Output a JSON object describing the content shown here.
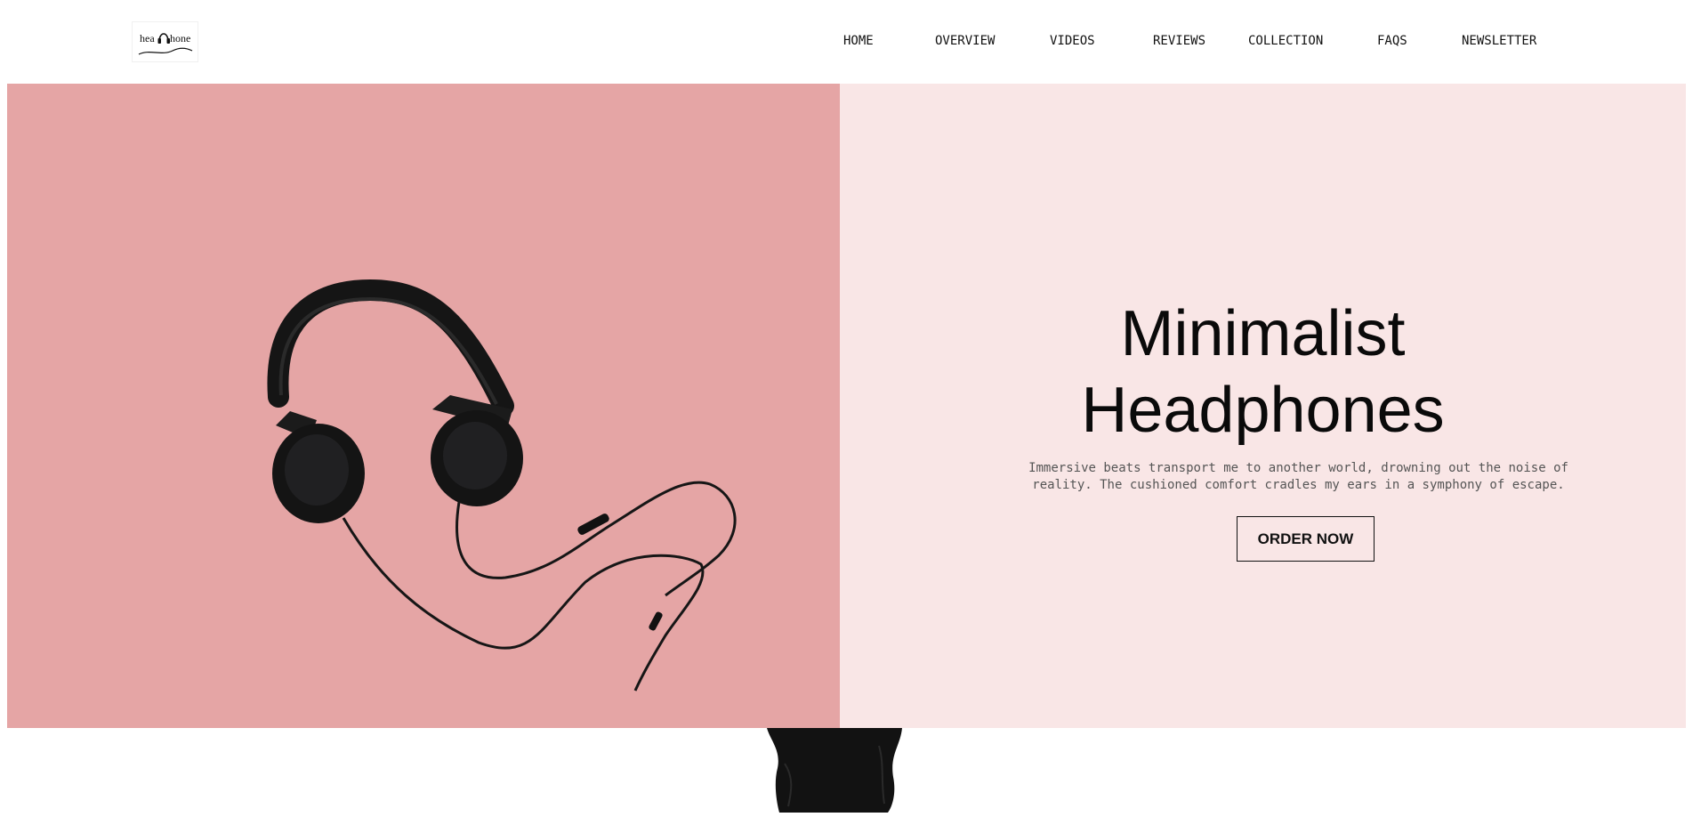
{
  "brand": {
    "logo_text_left": "hea",
    "logo_text_right": "hone",
    "logo_icon": "headphone-logo-icon"
  },
  "nav": {
    "items": [
      {
        "label": "HOME"
      },
      {
        "label": "OVERVIEW"
      },
      {
        "label": "VIDEOS"
      },
      {
        "label": "REVIEWS"
      },
      {
        "label": "COLLECTION"
      },
      {
        "label": "FAQS"
      },
      {
        "label": "NEWSLETTER"
      }
    ]
  },
  "hero": {
    "title_line1": "Minimalist",
    "title_line2": "Headphones",
    "tagline": "Immersive beats transport me to another world, drowning out the noise of reality. The cushioned comfort cradles my ears in a symphony of escape.",
    "cta_label": "ORDER NOW",
    "image_icon": "headphones-product-image"
  },
  "colors": {
    "hero_left_bg": "#e5a5a5",
    "hero_right_bg": "#f9e6e6",
    "text": "#0a0a0a"
  }
}
